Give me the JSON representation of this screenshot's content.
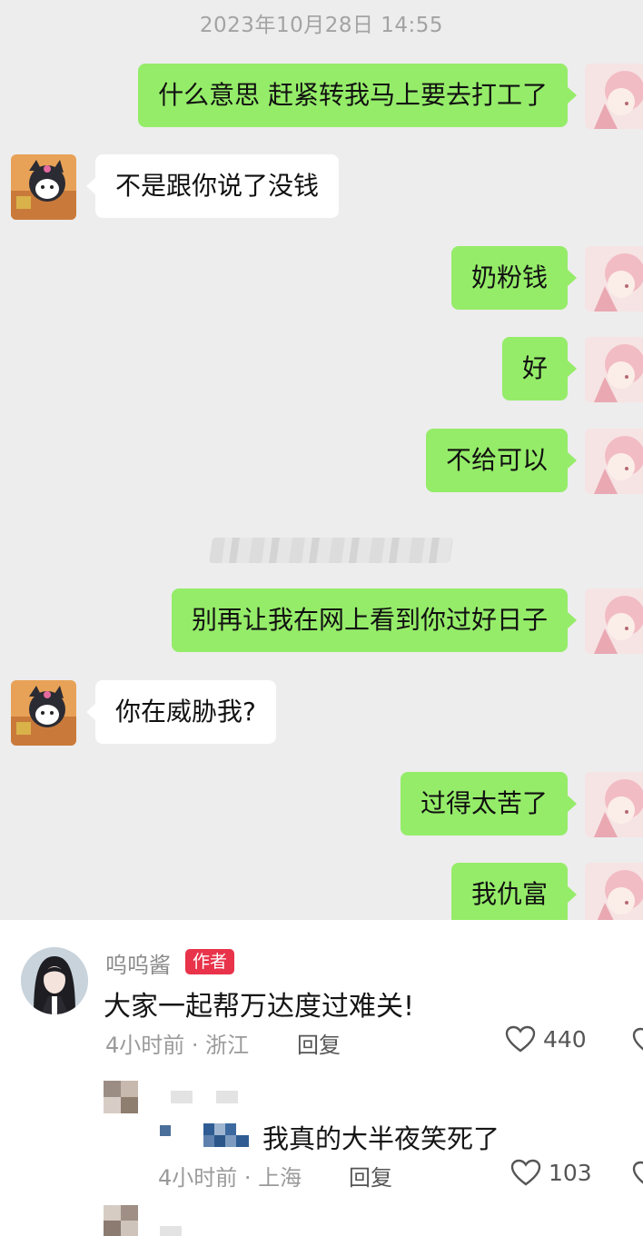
{
  "chat": {
    "timestamp": "2023年10月28日 14:55",
    "messages": [
      {
        "from": "me",
        "text": "什么意思 赶紧转我马上要去打工了"
      },
      {
        "from": "other",
        "text": "不是跟你说了没钱"
      },
      {
        "from": "me",
        "text": "奶粉钱"
      },
      {
        "from": "me",
        "text": "好"
      },
      {
        "from": "me",
        "text": "不给可以"
      },
      {
        "from": "me",
        "text": "别再让我在网上看到你过好日子"
      },
      {
        "from": "other",
        "text": "你在威胁我?"
      },
      {
        "from": "me",
        "text": "过得太苦了"
      },
      {
        "from": "me",
        "text": "我仇富"
      }
    ]
  },
  "comments": {
    "author": {
      "name": "呜呜酱",
      "badge": "作者",
      "text": "大家一起帮万达度过难关!",
      "meta": "4小时前 · 浙江",
      "reply": "回复",
      "likes": "440"
    },
    "reply": {
      "text": "我真的大半夜笑死了",
      "meta": "4小时前 · 上海",
      "reply": "回复",
      "likes": "103"
    }
  },
  "colors": {
    "chat_bg": "#ededed",
    "my_bubble": "#95ec69",
    "their_bubble": "#ffffff",
    "badge": "#e8334a"
  },
  "icons": [
    "heart-icon",
    "avatar-kuromi",
    "avatar-pink-anime"
  ]
}
